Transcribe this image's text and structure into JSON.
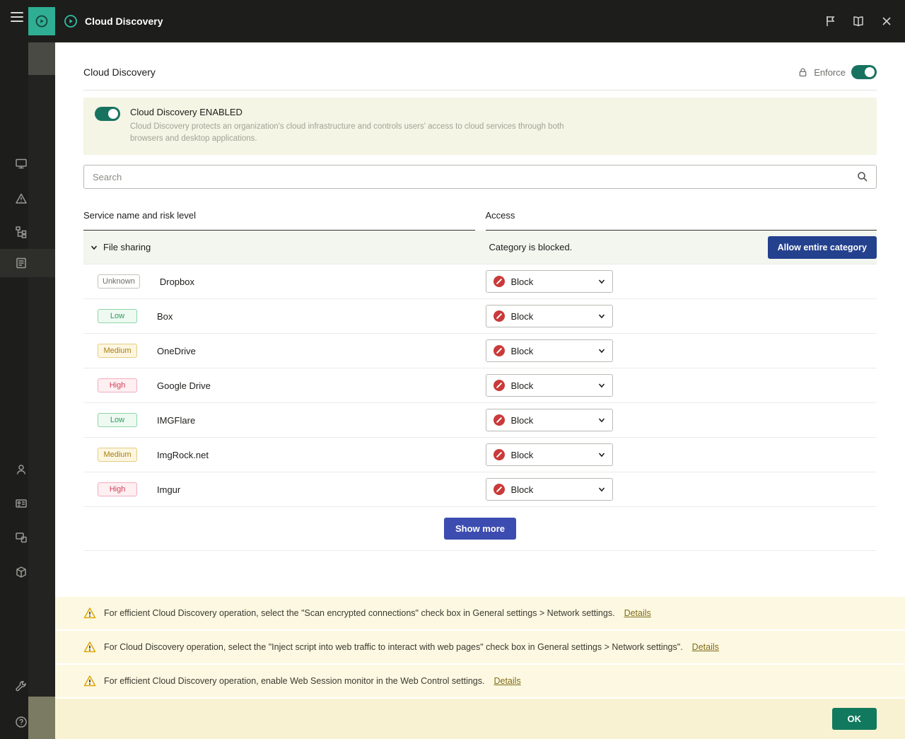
{
  "topbar": {
    "title": "Cloud Discovery",
    "icons": [
      "menu",
      "app",
      "flag",
      "book",
      "close"
    ]
  },
  "sidebar": {
    "icons": [
      "monitoring",
      "alerts",
      "hierarchy",
      "policies",
      "users",
      "licenses",
      "devices",
      "packages",
      "tools",
      "help"
    ]
  },
  "page": {
    "title": "Cloud Discovery",
    "enforce_label": "Enforce"
  },
  "banner": {
    "title": "Cloud Discovery ENABLED",
    "description": "Cloud Discovery protects an organization's cloud infrastructure and controls users' access to cloud services through both browsers and desktop applications."
  },
  "search": {
    "placeholder": "Search"
  },
  "table": {
    "col1": "Service name and risk level",
    "col2": "Access",
    "category": {
      "name": "File sharing",
      "status": "Category is blocked.",
      "action": "Allow entire category"
    },
    "rows": [
      {
        "risk": "Unknown",
        "risk_class": "unknown",
        "service": "Dropbox",
        "access": "Block"
      },
      {
        "risk": "Low",
        "risk_class": "low",
        "service": "Box",
        "access": "Block"
      },
      {
        "risk": "Medium",
        "risk_class": "medium",
        "service": "OneDrive",
        "access": "Block"
      },
      {
        "risk": "High",
        "risk_class": "high",
        "service": "Google Drive",
        "access": "Block"
      },
      {
        "risk": "Low",
        "risk_class": "low",
        "service": "IMGFlare",
        "access": "Block"
      },
      {
        "risk": "Medium",
        "risk_class": "medium",
        "service": "ImgRock.net",
        "access": "Block"
      },
      {
        "risk": "High",
        "risk_class": "high",
        "service": "Imgur",
        "access": "Block"
      }
    ],
    "show_more": "Show more"
  },
  "warnings": [
    {
      "text": "For efficient Cloud Discovery operation, select the \"Scan encrypted connections\" check box in General settings > Network settings.",
      "link": "Details"
    },
    {
      "text": "For Cloud Discovery operation, select the \"Inject script into web traffic to interact with web pages\" check box in General settings > Network settings\".",
      "link": "Details"
    },
    {
      "text": "For efficient Cloud Discovery operation, enable Web Session monitor in the Web Control settings.",
      "link": "Details"
    }
  ],
  "footer": {
    "ok": "OK"
  },
  "colors": {
    "accent_teal": "#2fae94",
    "toggle_on": "#17735f",
    "primary_blue": "#3c4cb0",
    "navy_button": "#24418e",
    "ok_green": "#11795d",
    "block_red": "#c93a3a"
  }
}
